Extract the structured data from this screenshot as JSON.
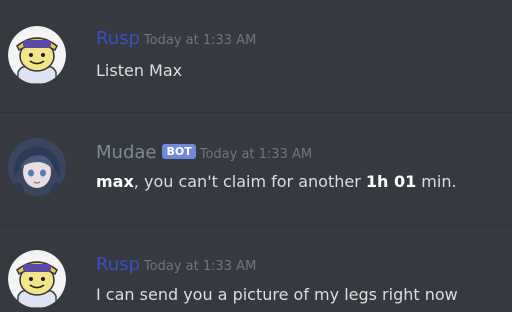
{
  "messages": [
    {
      "author": "Rusp",
      "author_color": "#3b4ec6",
      "timestamp": "Today at 1:33 AM",
      "text": "Listen Max",
      "avatar_icon": "smiley-hat-avatar-icon"
    },
    {
      "author": "Mudae",
      "author_color": "#7d8b96",
      "bot_tag": "BOT",
      "timestamp": "Today at 1:33 AM",
      "text_parts": {
        "p1_bold": "max",
        "p2": ", you can't claim for another ",
        "p3_bold": "1h 01",
        "p4": " min."
      },
      "avatar_icon": "anime-girl-avatar-icon"
    },
    {
      "author": "Rusp",
      "author_color": "#3b4ec6",
      "timestamp": "Today at 1:33 AM",
      "text": "I can send you a picture of my legs right now",
      "avatar_icon": "smiley-hat-avatar-icon"
    }
  ],
  "colors": {
    "background": "#36393f",
    "text": "#dcddde",
    "timestamp": "#72767d",
    "bot_tag_bg": "#7289da"
  }
}
